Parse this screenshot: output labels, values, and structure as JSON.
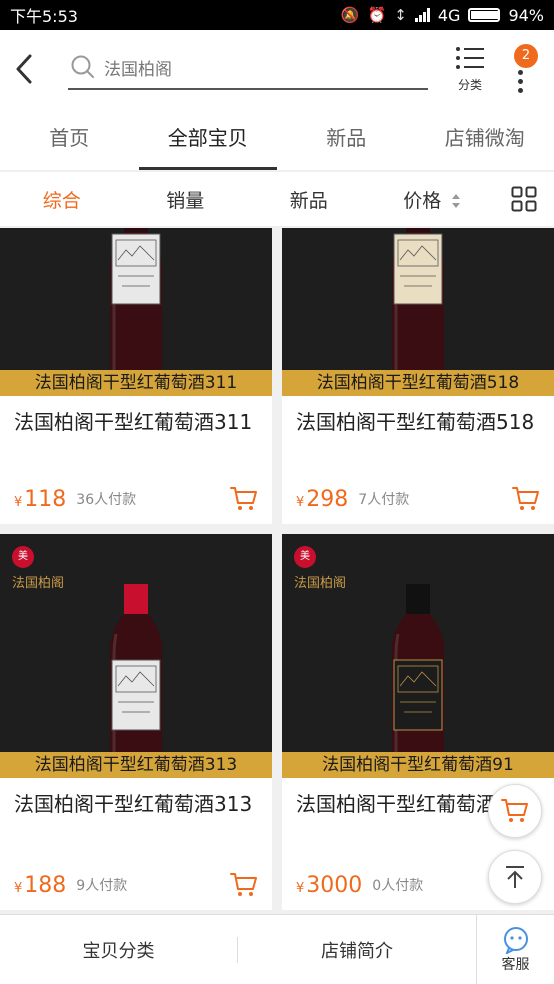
{
  "status_bar": {
    "time": "下午5:53",
    "network": "4G",
    "battery": "94%",
    "battery_level": 0.94
  },
  "header": {
    "search_placeholder": "法国柏阁",
    "category_label": "分类",
    "badge_count": "2"
  },
  "tabs": [
    {
      "label": "首页",
      "active": false
    },
    {
      "label": "全部宝贝",
      "active": true
    },
    {
      "label": "新品",
      "active": false
    },
    {
      "label": "店铺微淘",
      "active": false
    }
  ],
  "sort_bar": [
    {
      "label": "综合",
      "active": true
    },
    {
      "label": "销量",
      "active": false
    },
    {
      "label": "新品",
      "active": false
    },
    {
      "label": "价格",
      "active": false
    }
  ],
  "products": [
    {
      "banner": "法国柏阁干型红葡萄酒311",
      "title": "法国柏阁干型红葡萄酒311",
      "currency": "¥",
      "price": "118",
      "sold": "36人付款",
      "label_color": "#e8e8e8",
      "capsule_color": "#2a0c10",
      "show_logo": false
    },
    {
      "banner": "法国柏阁干型红葡萄酒518",
      "title": "法国柏阁干型红葡萄酒518",
      "currency": "¥",
      "price": "298",
      "sold": "7人付款",
      "label_color": "#e9ddc2",
      "capsule_color": "#2a0c10",
      "show_logo": false
    },
    {
      "banner": "法国柏阁干型红葡萄酒313",
      "title": "法国柏阁干型红葡萄酒313",
      "currency": "¥",
      "price": "188",
      "sold": "9人付款",
      "label_color": "#e8e8e8",
      "capsule_color": "#c8102e",
      "show_logo": true,
      "logo_text": "法国柏阁"
    },
    {
      "banner": "法国柏阁干型红葡萄酒91",
      "title": "法国柏阁干型红葡萄酒91",
      "currency": "¥",
      "price": "3000",
      "sold": "0人付款",
      "label_color": "#1c1c1c",
      "capsule_color": "#111111",
      "show_logo": true,
      "logo_text": "法国柏阁"
    }
  ],
  "bottom_bar": {
    "category": "宝贝分类",
    "store_intro": "店铺简介",
    "service": "客服"
  },
  "colors": {
    "accent": "#f06a1d",
    "banner": "#d6a53a"
  }
}
